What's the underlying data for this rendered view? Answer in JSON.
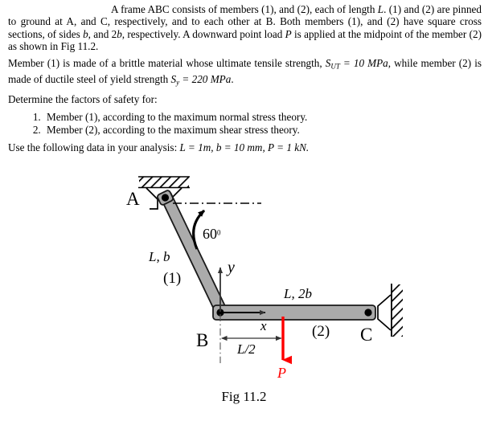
{
  "document": {
    "paragraph1": {
      "sentence1": "A frame ABC consists of members (1), and (2), each of length ",
      "sym_L": "L",
      "sentence1b": ". (1) and (2) are pinned to ground at A, and C, respectively, and to each other at B. Both members (1), and (2) have square cross sections, of sides ",
      "sym_b": "b",
      "sentence1c": ", and 2",
      "sym_b2": "b",
      "sentence1d": ", respectively. A downward point load ",
      "sym_P": "P",
      "sentence1e": " is applied at the midpoint of the member (2) as shown in Fig 11.2."
    },
    "paragraph2": {
      "part1": "Member (1) is made of a brittle material whose ultimate tensile strength, ",
      "sym_Sut": "S",
      "sub_ut": "UT",
      "part2": " = 10 ",
      "unit_mpa": "MPa",
      "part3": ", while member (2) is made of ductile steel of yield strength ",
      "sym_Sy": "S",
      "sub_y": "y",
      "part4": " = 220 ",
      "unit_mpa2": "MPa",
      "part5": "."
    },
    "prompt": "Determine the factors of safety for:",
    "questions": [
      "Member (1), according to the maximum normal stress theory.",
      "Member (2), according to the maximum shear stress theory."
    ],
    "data_line": {
      "lead": "Use the following data in your analysis: ",
      "values": "L = 1m, b = 10 mm, P = 1 kN."
    },
    "caption": "Fig 11.2"
  },
  "figure": {
    "labels": {
      "point_a": "A",
      "point_b": "B",
      "point_c": "C",
      "angle": "60",
      "angle_deg": "0",
      "member1_dims": "L, b",
      "member1_id": "(1)",
      "member2_dims": "L, 2b",
      "member2_id": "(2)",
      "axis_x": "x",
      "axis_y": "y",
      "half_length": "L/2",
      "load": "P"
    },
    "colors": {
      "member_fill": "#ABABAB",
      "member_stroke": "#1a1a1a",
      "load_arrow": "#FF0000",
      "hatch": "#000000",
      "axis": "#333333",
      "centerline": "#000000"
    }
  }
}
